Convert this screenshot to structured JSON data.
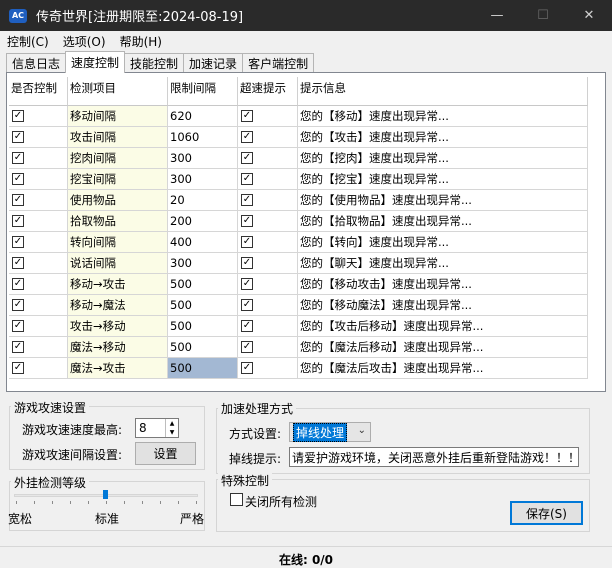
{
  "window": {
    "title": "传奇世界[注册期限至:2024-08-19]",
    "icon_text": "AC",
    "minimize_icon": "—",
    "maximize_icon": "☐",
    "close_icon": "✕"
  },
  "menu": [
    "控制(C)",
    "选项(O)",
    "帮助(H)"
  ],
  "tabs": [
    "信息日志",
    "速度控制",
    "技能控制",
    "加速记录",
    "客户端控制"
  ],
  "active_tab": "速度控制",
  "table": {
    "columns": [
      "是否控制",
      "检测项目",
      "限制间隔",
      "超速提示",
      "提示信息"
    ],
    "rows": [
      {
        "item": "移动间隔",
        "interval": "620",
        "message": "您的【移动】速度出现异常..."
      },
      {
        "item": "攻击间隔",
        "interval": "1060",
        "message": "您的【攻击】速度出现异常..."
      },
      {
        "item": "挖肉间隔",
        "interval": "300",
        "message": "您的【挖肉】速度出现异常..."
      },
      {
        "item": "挖宝间隔",
        "interval": "300",
        "message": "您的【挖宝】速度出现异常..."
      },
      {
        "item": "使用物品",
        "interval": "20",
        "message": "您的【使用物品】速度出现异常..."
      },
      {
        "item": "拾取物品",
        "interval": "200",
        "message": "您的【拾取物品】速度出现异常..."
      },
      {
        "item": "转向间隔",
        "interval": "400",
        "message": "您的【转向】速度出现异常..."
      },
      {
        "item": "说话间隔",
        "interval": "300",
        "message": "您的【聊天】速度出现异常..."
      },
      {
        "item": "移动→攻击",
        "interval": "500",
        "message": "您的【移动攻击】速度出现异常..."
      },
      {
        "item": "移动→魔法",
        "interval": "500",
        "message": "您的【移动魔法】速度出现异常..."
      },
      {
        "item": "攻击→移动",
        "interval": "500",
        "message": "您的【攻击后移动】速度出现异常..."
      },
      {
        "item": "魔法→移动",
        "interval": "500",
        "message": "您的【魔法后移动】速度出现异常..."
      },
      {
        "item": "魔法→攻击",
        "interval": "500",
        "message": "您的【魔法后攻击】速度出现异常..."
      }
    ]
  },
  "game_speed": {
    "title": "游戏攻速设置",
    "max_label": "游戏攻速速度最高:",
    "max_value": "8",
    "interval_label": "游戏攻速间隔设置:",
    "settings_button": "设置"
  },
  "detection_level": {
    "title": "外挂检测等级",
    "low": "宽松",
    "mid": "标准",
    "high": "严格",
    "level": "标准"
  },
  "accel": {
    "title": "加速处理方式",
    "method_label": "方式设置:",
    "method_value": "掉线处理",
    "tip_label": "掉线提示:",
    "tip_value": "请爱护游戏环境，关闭恶意外挂后重新登陆游戏！！！"
  },
  "special": {
    "title": "特殊控制",
    "close_all_label": "关闭所有检测",
    "save_button": "保存(S)"
  },
  "status": {
    "online": "在线: 0/0"
  }
}
